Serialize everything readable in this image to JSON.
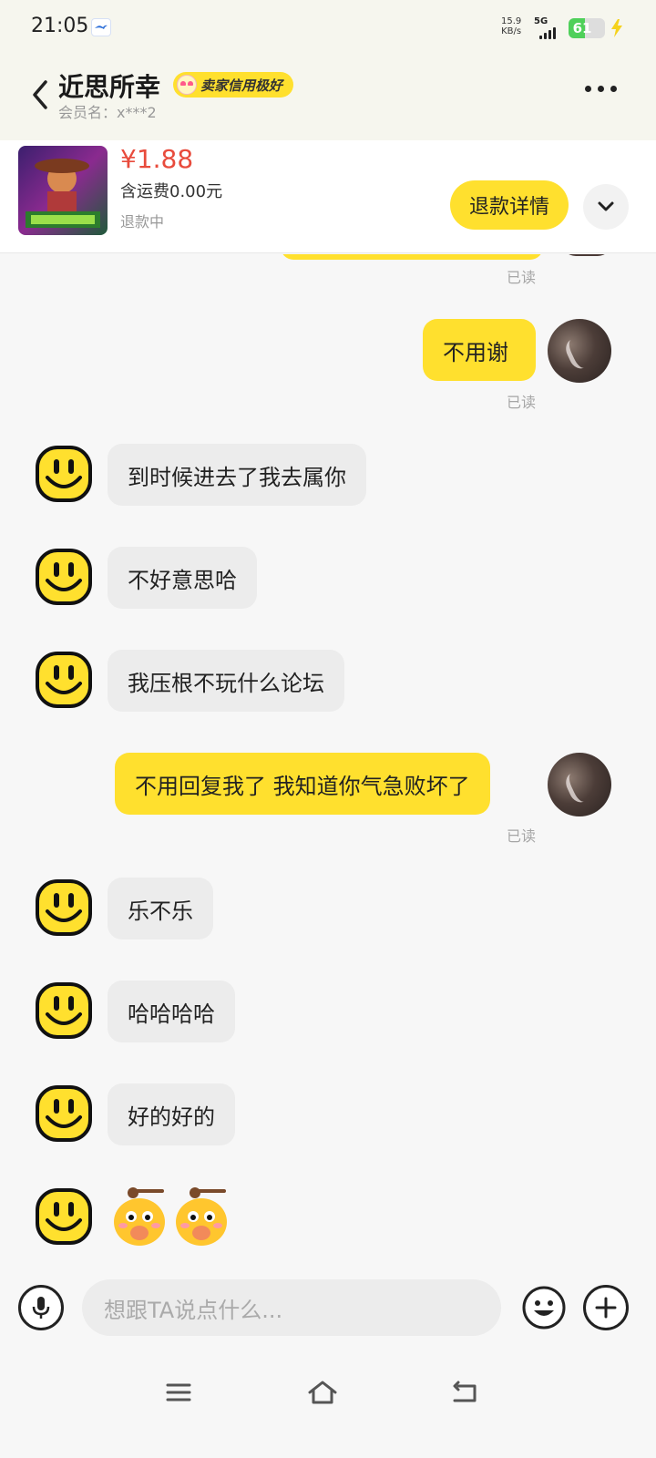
{
  "status_bar": {
    "time": "21:05",
    "net_speed_value": "15.9",
    "net_speed_unit": "KB/s",
    "network": "5G",
    "battery_level": 61,
    "battery_text": "61"
  },
  "header": {
    "seller_name": "近思所幸",
    "credit_badge": "卖家信用极好",
    "member_label": "会员名：x***2"
  },
  "product": {
    "price": "¥1.88",
    "shipping": "含运费0.00元",
    "status": "退款中",
    "refund_button": "退款详情"
  },
  "messages": [
    {
      "sender": "me",
      "text": "不用谢",
      "read": "已读"
    },
    {
      "sender": "them",
      "text": "到时候进去了我去属你"
    },
    {
      "sender": "them",
      "text": "不好意思哈"
    },
    {
      "sender": "them",
      "text": "我压根不玩什么论坛"
    },
    {
      "sender": "me",
      "text": "不用回复我了 我知道你气急败坏了",
      "read": "已读"
    },
    {
      "sender": "them",
      "text": "乐不乐"
    },
    {
      "sender": "them",
      "text": "哈哈哈哈"
    },
    {
      "sender": "them",
      "text": "好的好的"
    },
    {
      "sender": "them",
      "sticker": "shy-salute-emoji"
    }
  ],
  "top_read_label": "已读",
  "input": {
    "placeholder": "想跟TA说点什么..."
  },
  "icons": {
    "back": "back-arrow-icon",
    "more": "more-icon",
    "voice": "microphone-icon",
    "emoji": "emoji-icon",
    "plus": "plus-icon",
    "nav_menu": "menu-icon",
    "nav_home": "home-icon",
    "nav_back": "back-icon"
  },
  "colors": {
    "accent": "#ffe02e",
    "price": "#e84b3c",
    "bubble_them": "#ececec"
  }
}
